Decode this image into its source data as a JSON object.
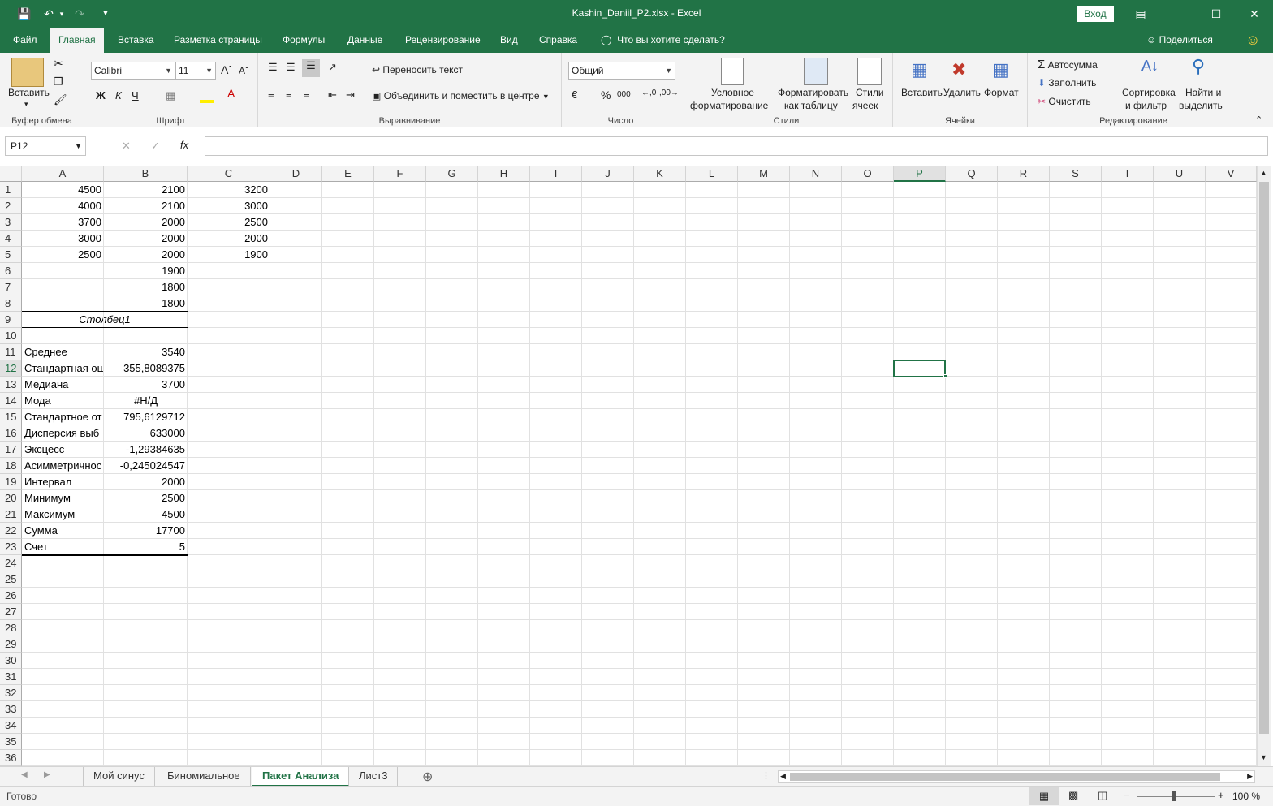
{
  "window": {
    "title": "Kashin_Daniil_P2.xlsx  -  Excel",
    "signin": "Вход"
  },
  "colors": {
    "accent": "#217346"
  },
  "ribbon_tabs": [
    "Файл",
    "Главная",
    "Вставка",
    "Разметка страницы",
    "Формулы",
    "Данные",
    "Рецензирование",
    "Вид",
    "Справка"
  ],
  "tell_me": "Что вы хотите сделать?",
  "share": "Поделиться",
  "clipboard": {
    "paste": "Вставить",
    "label": "Буфер обмена"
  },
  "font": {
    "name": "Calibri",
    "size": "11",
    "bold": "Ж",
    "italic": "К",
    "underline": "Ч",
    "label": "Шрифт"
  },
  "alignment": {
    "wrap": "Переносить текст",
    "merge": "Объединить и поместить в центре",
    "label": "Выравнивание"
  },
  "number": {
    "format": "Общий",
    "percent": "%",
    "thousands": "000",
    "label": "Число"
  },
  "styles": {
    "conditional1": "Условное",
    "conditional2": "форматирование",
    "astable1": "Форматировать",
    "astable2": "как таблицу",
    "cell1": "Стили",
    "cell2": "ячеек",
    "label": "Стили"
  },
  "cells": {
    "insert": "Вставить",
    "delete": "Удалить",
    "format": "Формат",
    "label": "Ячейки"
  },
  "editing": {
    "autosum": "Автосумма",
    "fill": "Заполнить",
    "clear": "Очистить",
    "sort1": "Сортировка",
    "sort2": "и фильтр",
    "find1": "Найти и",
    "find2": "выделить",
    "label": "Редактирование"
  },
  "namebox": "P12",
  "columns": [
    "A",
    "B",
    "C",
    "D",
    "E",
    "F",
    "G",
    "H",
    "I",
    "J",
    "K",
    "L",
    "M",
    "N",
    "O",
    "P",
    "Q",
    "R",
    "S",
    "T",
    "U",
    "V"
  ],
  "selected_column": "P",
  "selected_row": 12,
  "rows": [
    {
      "n": 1,
      "A": "4500",
      "B": "2100",
      "C": "3200"
    },
    {
      "n": 2,
      "A": "4000",
      "B": "2100",
      "C": "3000"
    },
    {
      "n": 3,
      "A": "3700",
      "B": "2000",
      "C": "2500"
    },
    {
      "n": 4,
      "A": "3000",
      "B": "2000",
      "C": "2000"
    },
    {
      "n": 5,
      "A": "2500",
      "B": "2000",
      "C": "1900"
    },
    {
      "n": 6,
      "B": "1900"
    },
    {
      "n": 7,
      "B": "1800"
    },
    {
      "n": 8,
      "B": "1800"
    },
    {
      "n": 9,
      "AB": "Столбец1"
    },
    {
      "n": 10
    },
    {
      "n": 11,
      "A": "Среднее",
      "B": "3540"
    },
    {
      "n": 12,
      "A": "Стандартная ош",
      "B": "355,8089375"
    },
    {
      "n": 13,
      "A": "Медиана",
      "B": "3700"
    },
    {
      "n": 14,
      "A": "Мода",
      "B": "#Н/Д"
    },
    {
      "n": 15,
      "A": "Стандартное от",
      "B": "795,6129712"
    },
    {
      "n": 16,
      "A": "Дисперсия выб",
      "B": "633000"
    },
    {
      "n": 17,
      "A": "Эксцесс",
      "B": "-1,29384635"
    },
    {
      "n": 18,
      "A": "Асимметричнос",
      "B": "-0,245024547"
    },
    {
      "n": 19,
      "A": "Интервал",
      "B": "2000"
    },
    {
      "n": 20,
      "A": "Минимум",
      "B": "2500"
    },
    {
      "n": 21,
      "A": "Максимум",
      "B": "4500"
    },
    {
      "n": 22,
      "A": "Сумма",
      "B": "17700"
    },
    {
      "n": 23,
      "A": "Счет",
      "B": "5"
    },
    {
      "n": 24
    },
    {
      "n": 25
    },
    {
      "n": 26
    },
    {
      "n": 27
    },
    {
      "n": 28
    },
    {
      "n": 29
    },
    {
      "n": 30
    },
    {
      "n": 31
    },
    {
      "n": 32
    },
    {
      "n": 33
    },
    {
      "n": 34
    },
    {
      "n": 35
    },
    {
      "n": 36
    }
  ],
  "sheets": [
    "Мой синус",
    "Биномиальное",
    "Пакет Анализа",
    "Лист3"
  ],
  "active_sheet": "Пакет Анализа",
  "status": {
    "ready": "Готово",
    "zoom": "100 %"
  }
}
